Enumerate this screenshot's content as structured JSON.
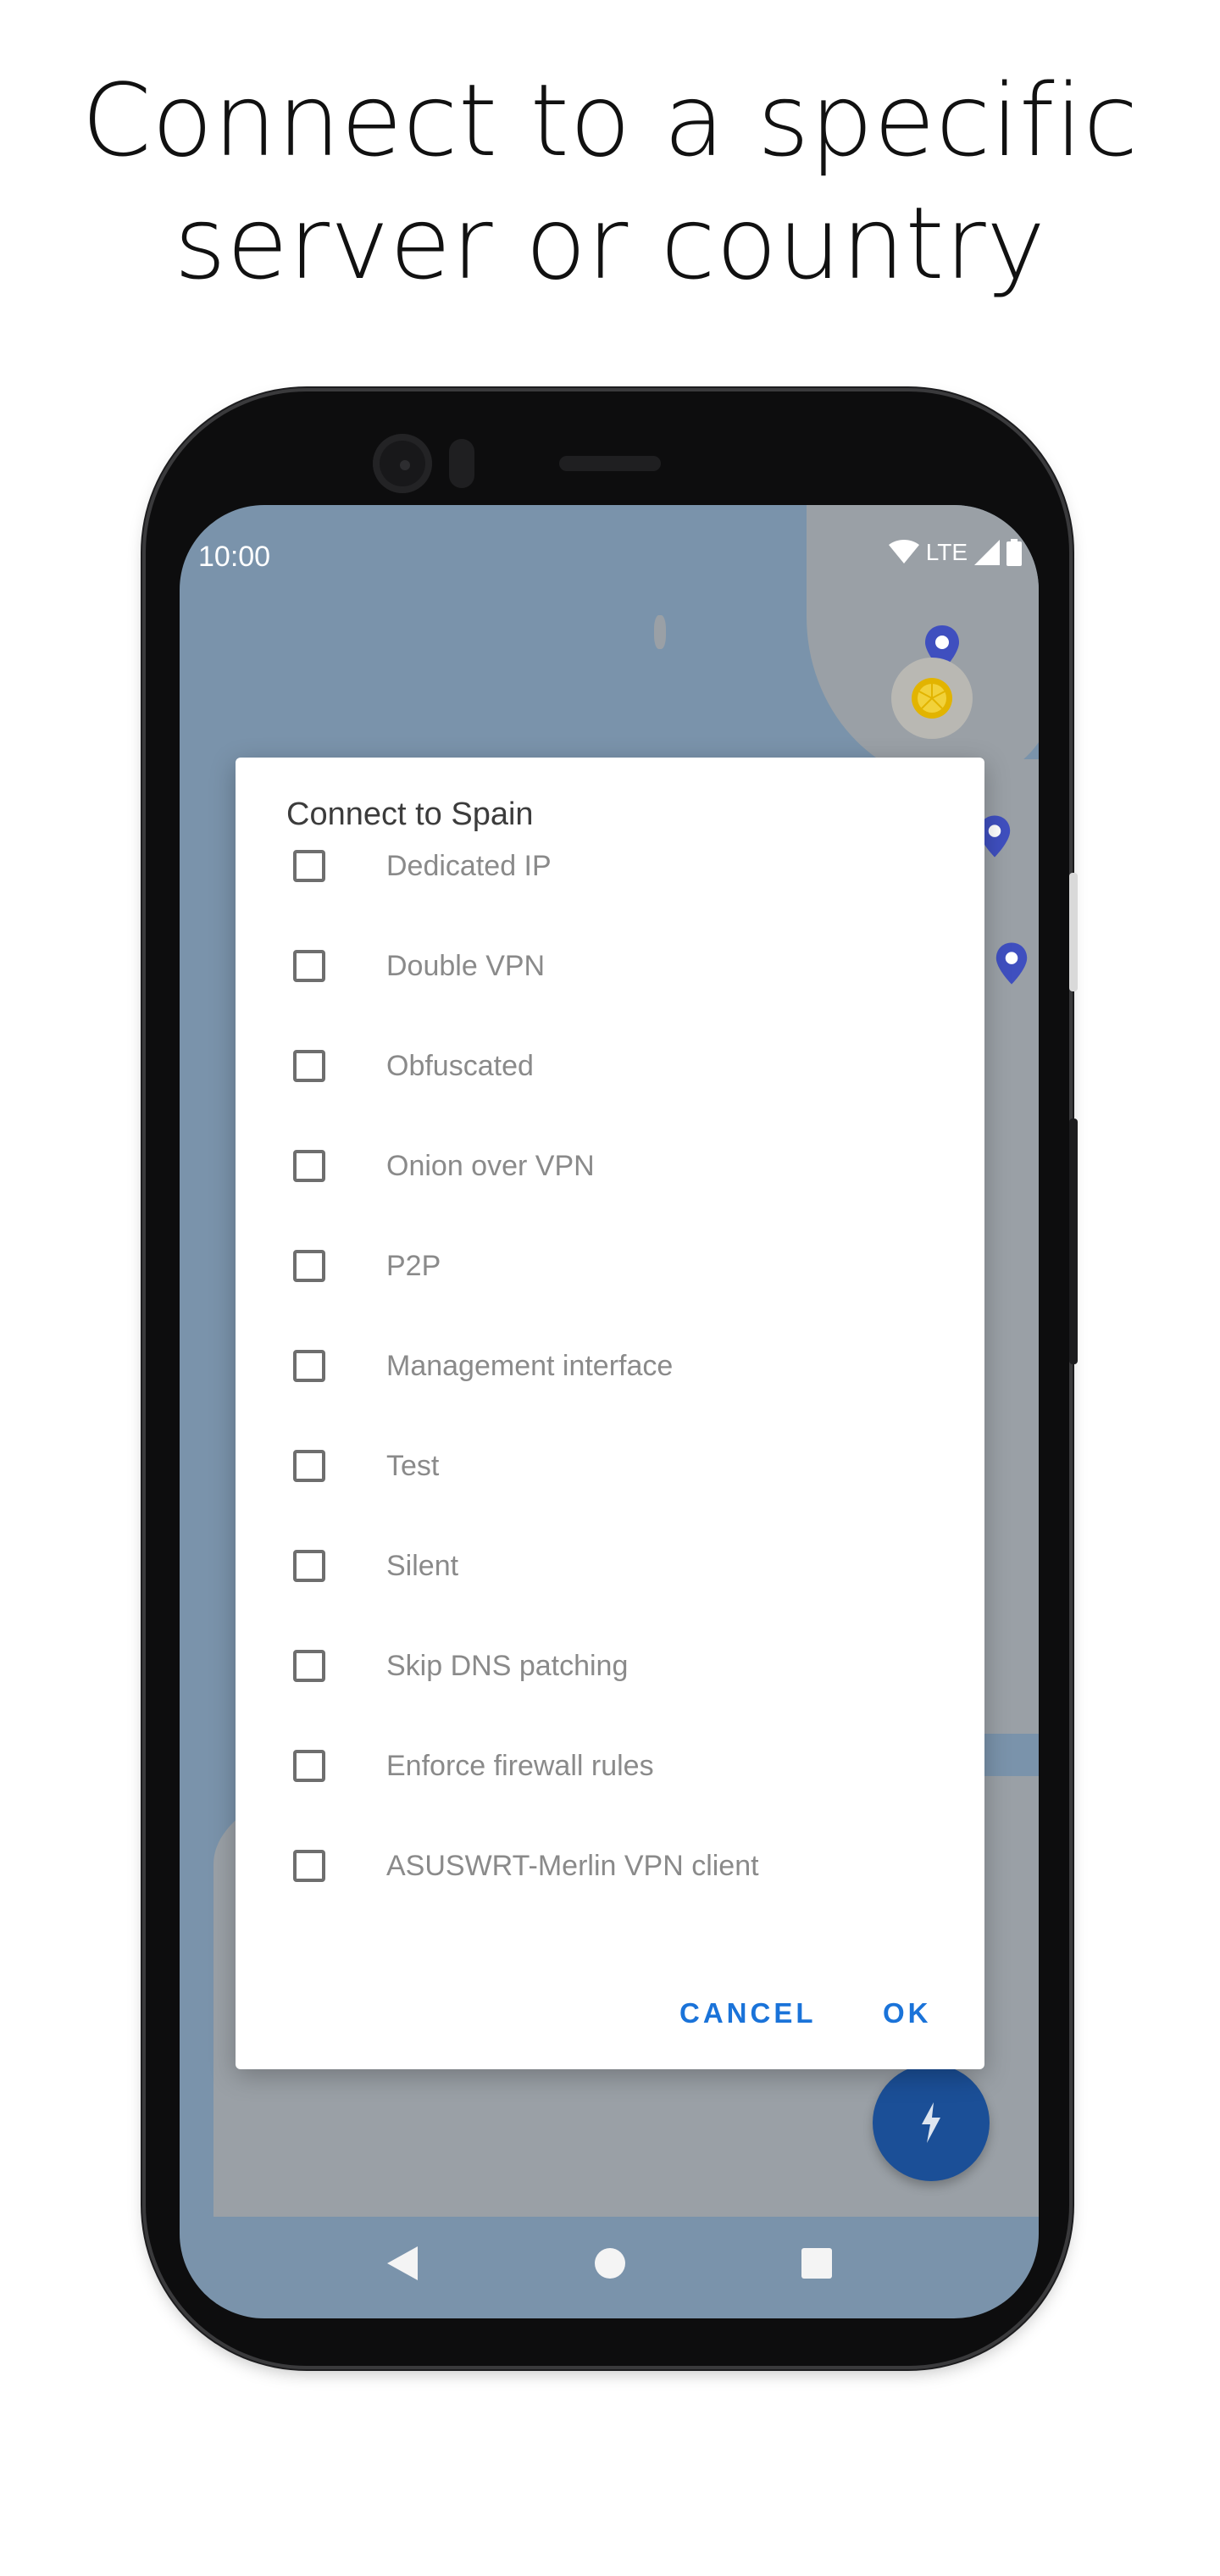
{
  "headline": {
    "line1": "Connect to a specific",
    "line2": "server or country"
  },
  "status_bar": {
    "time": "10:00",
    "network": "LTE"
  },
  "dialog": {
    "title": "Connect to Spain",
    "options": [
      {
        "label": "Dedicated IP",
        "checked": false
      },
      {
        "label": "Double VPN",
        "checked": false
      },
      {
        "label": "Obfuscated",
        "checked": false
      },
      {
        "label": "Onion over VPN",
        "checked": false
      },
      {
        "label": "P2P",
        "checked": false
      },
      {
        "label": "Management interface",
        "checked": false
      },
      {
        "label": "Test",
        "checked": false
      },
      {
        "label": "Silent",
        "checked": false
      },
      {
        "label": "Skip DNS patching",
        "checked": false
      },
      {
        "label": "Enforce firewall rules",
        "checked": false
      },
      {
        "label": "ASUSWRT-Merlin VPN client",
        "checked": false
      }
    ],
    "cancel_label": "CANCEL",
    "ok_label": "OK"
  },
  "colors": {
    "accent": "#1a73d9",
    "fab": "#1b4f97",
    "map_water": "#7f9ab2",
    "pin": "#3f4fbf"
  },
  "icons": {
    "wifi": "wifi-icon",
    "signal": "signal-icon",
    "battery": "battery-icon",
    "fab": "quick-connect-bolt-icon",
    "back": "back-triangle-icon",
    "home": "home-circle-icon",
    "recents": "recents-square-icon"
  }
}
